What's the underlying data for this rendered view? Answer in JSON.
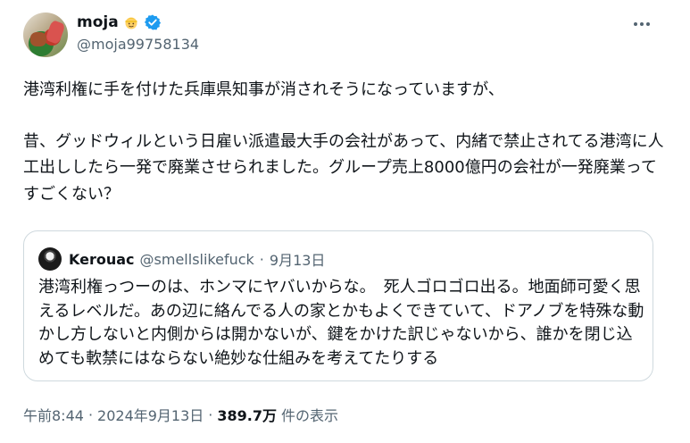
{
  "author": {
    "display_name": "moja",
    "handle": "@moja99758134",
    "name_emoji": "person-blond-hair-emoji",
    "verified_color": "#1d9bf0"
  },
  "tweet": {
    "para1": "港湾利権に手を付けた兵庫県知事が消されそうになっていますが、",
    "para2": "昔、グッドウィルという日雇い派遣最大手の会社があって、内緒で禁止されてる港湾に人工出ししたら一発で廃業させられました。グループ売上8000億円の会社が一発廃業ってすごくない？"
  },
  "quote": {
    "display_name": "Kerouac",
    "handle": "@smellslikefuck",
    "separator": "·",
    "date": "9月13日",
    "text": "港湾利権っつーのは、ホンマにヤバいからな。　死人ゴロゴロ出る。地面師可愛く思えるレベルだ。あの辺に絡んでる人の家とかもよくできていて、ドアノブを特殊な動かし方しないと内側からは開かないが、鍵をかけた訳じゃないから、誰かを閉じ込めても軟禁にはならない絶妙な仕組みを考えてたりする"
  },
  "meta": {
    "time": "午前8:44",
    "separator": "·",
    "date": "2024年9月13日",
    "views_count": "389.7万",
    "views_label": "件の表示"
  },
  "icons": {
    "more": "more-horizontal-icon",
    "verified": "verified-badge-icon"
  }
}
